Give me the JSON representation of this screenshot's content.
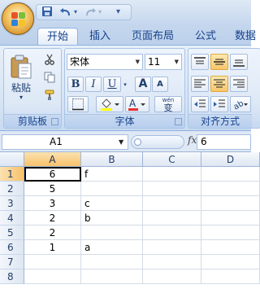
{
  "quick_access": {
    "save_icon": "save-icon",
    "undo_icon": "undo-icon",
    "redo_icon": "redo-icon",
    "customize_icon": "customize-icon"
  },
  "tabs": [
    {
      "label": "开始",
      "active": true
    },
    {
      "label": "插入",
      "active": false
    },
    {
      "label": "页面布局",
      "active": false
    },
    {
      "label": "公式",
      "active": false
    },
    {
      "label": "数据",
      "active": false
    }
  ],
  "ribbon": {
    "clipboard": {
      "label": "剪贴板",
      "paste_label": "粘贴",
      "paste_arrow": "▾",
      "cut_icon": "scissors-icon",
      "copy_icon": "copy-icon",
      "format_painter_icon": "paintbrush-icon"
    },
    "font": {
      "label": "字体",
      "font_name": "宋体",
      "font_size": "11",
      "bold": "B",
      "italic": "I",
      "underline": "U",
      "grow": "A",
      "shrink": "A",
      "phonetic": "wén",
      "phonetic_char": "变"
    },
    "alignment": {
      "label": "对齐方式"
    }
  },
  "formula_bar": {
    "name_box": "A1",
    "fx_label": "fx",
    "value": "6"
  },
  "sheet": {
    "columns": [
      "A",
      "B",
      "C",
      "D"
    ],
    "rows": [
      {
        "n": "1",
        "a": "6",
        "b": "f"
      },
      {
        "n": "2",
        "a": "5",
        "b": ""
      },
      {
        "n": "3",
        "a": "3",
        "b": "c"
      },
      {
        "n": "4",
        "a": "2",
        "b": "b"
      },
      {
        "n": "5",
        "a": "2",
        "b": ""
      },
      {
        "n": "6",
        "a": "1",
        "b": "a"
      },
      {
        "n": "7",
        "a": "",
        "b": ""
      },
      {
        "n": "8",
        "a": "",
        "b": ""
      }
    ],
    "selected_cell": "A1"
  },
  "colors": {
    "accent": "#15428b",
    "selection_header": "#f7c16b",
    "ribbon_bg": "#dbe6f5"
  }
}
